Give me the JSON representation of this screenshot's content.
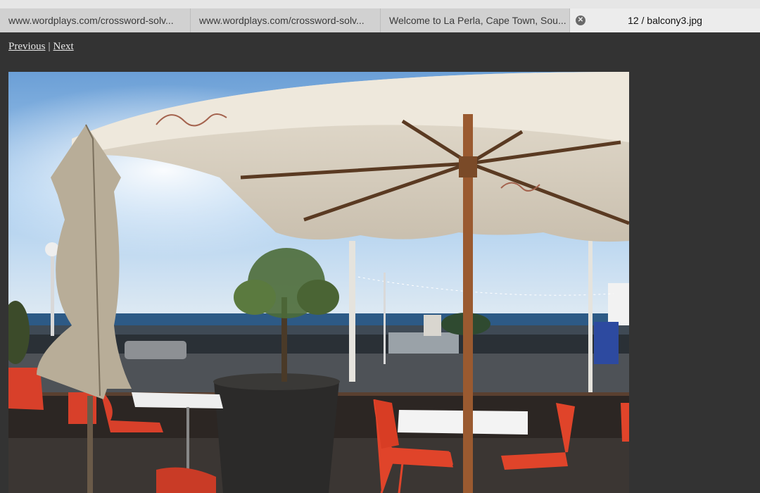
{
  "browser": {
    "tabs": [
      {
        "label": "www.wordplays.com/crossword-solv..."
      },
      {
        "label": "www.wordplays.com/crossword-solv..."
      },
      {
        "label": "Welcome to La Perla, Cape Town, Sou..."
      }
    ],
    "active_tab": {
      "title": "12 / balcony3.jpg",
      "close_icon": "close-icon"
    }
  },
  "nav": {
    "previous_label": "Previous",
    "separator": "|",
    "next_label": "Next"
  },
  "photo": {
    "description_icon": "photo-balcony",
    "colors": {
      "sky": "#8fbde8",
      "sea": "#2d5a86",
      "umbrella": "#d9d2c4",
      "chair": "#e0442a"
    }
  }
}
